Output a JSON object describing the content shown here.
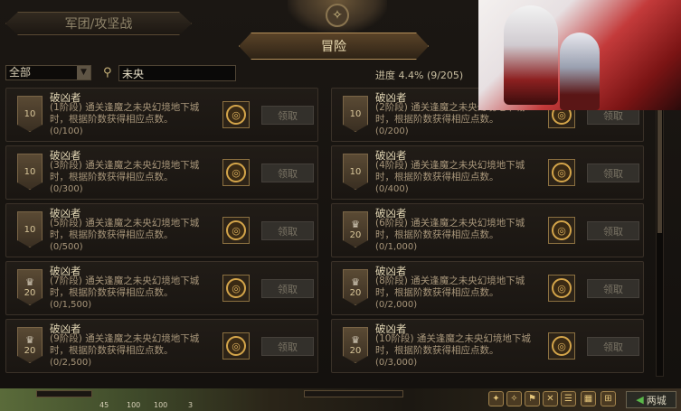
{
  "tabs": {
    "left": "军团/攻坚战",
    "center": "冒险"
  },
  "filter": {
    "selected": "全部",
    "search_value": "未央"
  },
  "progress": {
    "text": "进度 4.4% (9/205)",
    "percent": 4.4
  },
  "claim_label": "领取",
  "achievements": [
    {
      "badge": "10",
      "trophy": false,
      "title": "破凶者",
      "desc": "(1阶段) 通关逢魔之未央幻境地下城时，根据阶数获得相应点数。",
      "count": "(0/100)"
    },
    {
      "badge": "10",
      "trophy": false,
      "title": "破凶者",
      "desc": "(2阶段) 通关逢魔之未央幻境地下城时，根据阶数获得相应点数。",
      "count": "(0/200)"
    },
    {
      "badge": "10",
      "trophy": false,
      "title": "破凶者",
      "desc": "(3阶段) 通关逢魔之未央幻境地下城时，根据阶数获得相应点数。",
      "count": "(0/300)"
    },
    {
      "badge": "10",
      "trophy": false,
      "title": "破凶者",
      "desc": "(4阶段) 通关逢魔之未央幻境地下城时，根据阶数获得相应点数。",
      "count": "(0/400)"
    },
    {
      "badge": "10",
      "trophy": false,
      "title": "破凶者",
      "desc": "(5阶段) 通关逢魔之未央幻境地下城时，根据阶数获得相应点数。",
      "count": "(0/500)"
    },
    {
      "badge": "20",
      "trophy": true,
      "title": "破凶者",
      "desc": "(6阶段) 通关逢魔之未央幻境地下城时，根据阶数获得相应点数。",
      "count": "(0/1,000)"
    },
    {
      "badge": "20",
      "trophy": true,
      "title": "破凶者",
      "desc": "(7阶段) 通关逢魔之未央幻境地下城时，根据阶数获得相应点数。",
      "count": "(0/1,500)"
    },
    {
      "badge": "20",
      "trophy": true,
      "title": "破凶者",
      "desc": "(8阶段) 通关逢魔之未央幻境地下城时，根据阶数获得相应点数。",
      "count": "(0/2,000)"
    },
    {
      "badge": "20",
      "trophy": true,
      "title": "破凶者",
      "desc": "(9阶段) 通关逢魔之未央幻境地下城时，根据阶数获得相应点数。",
      "count": "(0/2,500)"
    },
    {
      "badge": "20",
      "trophy": true,
      "title": "破凶者",
      "desc": "(10阶段) 通关逢魔之未央幻境地下城时，根据阶数获得相应点数。",
      "count": "(0/3,000)"
    }
  ],
  "hud": {
    "level": "45",
    "hp": "100",
    "mp": "100",
    "potions": "3",
    "town_label": "两城"
  },
  "colors": {
    "accent": "#b59059",
    "panel": "#1b1713"
  }
}
